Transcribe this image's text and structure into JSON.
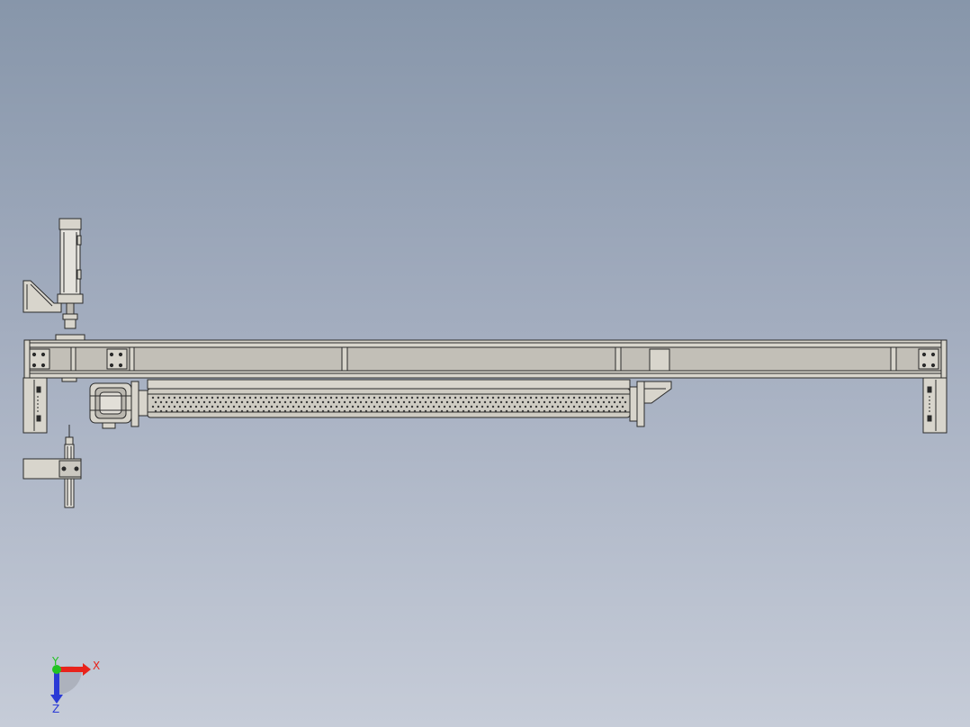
{
  "viewport": {
    "background_top": "#8796aa",
    "background_bottom": "#c6ccd8"
  },
  "model": {
    "part_color": "#d8d5cc",
    "line_color": "#2a2a2a",
    "roller_color": "#cfccc3"
  },
  "triad": {
    "x_label": "X",
    "y_label": "Y",
    "z_label": "Z",
    "x_color": "#e8231b",
    "y_color": "#22c322",
    "z_color": "#2a3ad6"
  }
}
